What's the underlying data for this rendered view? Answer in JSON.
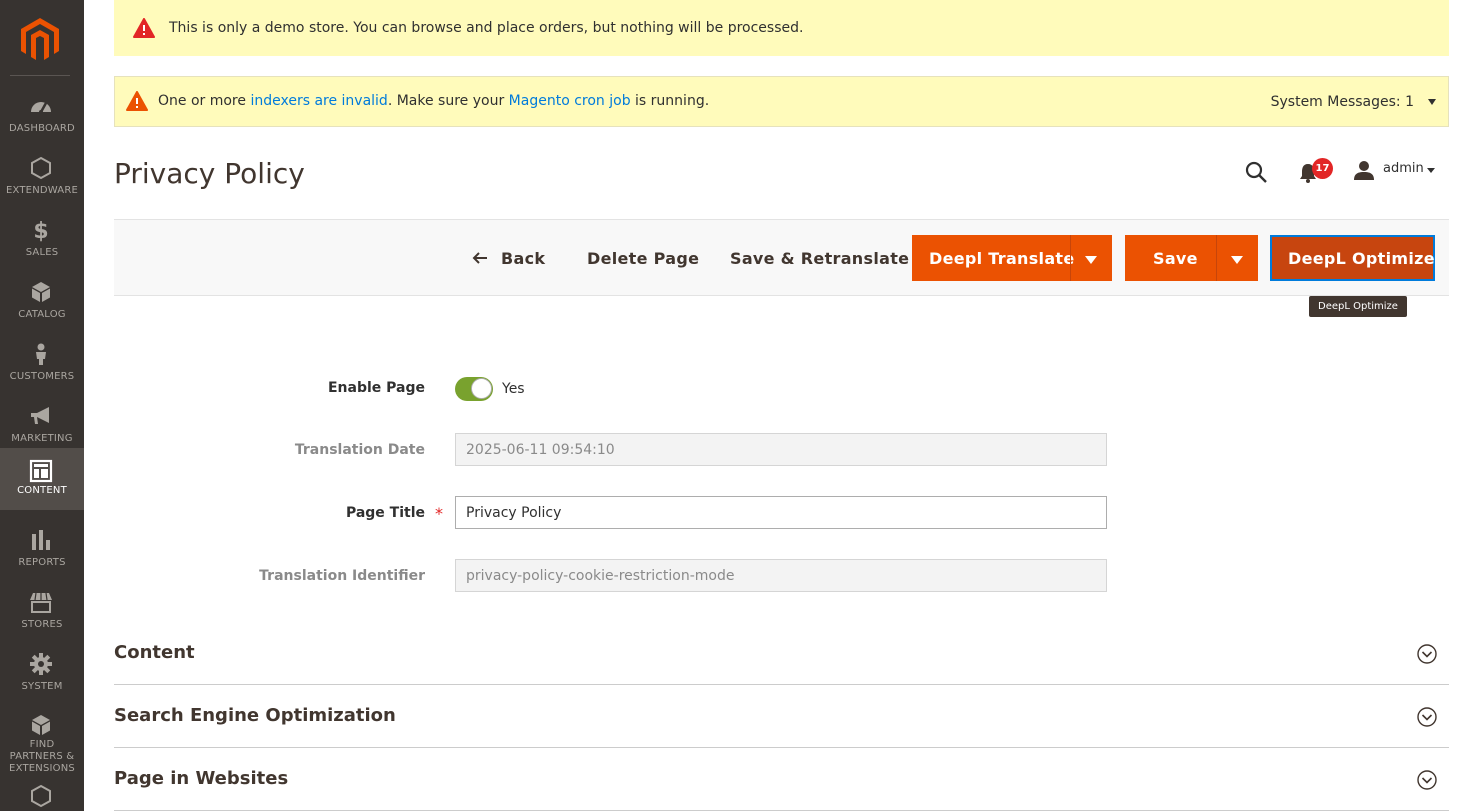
{
  "sidebar": {
    "items": [
      {
        "label": "DASHBOARD",
        "icon": "dashboard-icon"
      },
      {
        "label": "EXTENDWARE",
        "icon": "hexagon-icon"
      },
      {
        "label": "SALES",
        "icon": "dollar-icon"
      },
      {
        "label": "CATALOG",
        "icon": "box-icon"
      },
      {
        "label": "CUSTOMERS",
        "icon": "person-icon"
      },
      {
        "label": "MARKETING",
        "icon": "megaphone-icon"
      },
      {
        "label": "CONTENT",
        "icon": "layout-icon"
      },
      {
        "label": "REPORTS",
        "icon": "bar-chart-icon"
      },
      {
        "label": "STORES",
        "icon": "store-icon"
      },
      {
        "label": "SYSTEM",
        "icon": "gear-icon"
      },
      {
        "label": "FIND PARTNERS & EXTENSIONS",
        "icon": "blocks-icon"
      }
    ]
  },
  "notices": {
    "demo": "This is only a demo store. You can browse and place orders, but nothing will be processed.",
    "indexer_prefix": "One or more ",
    "indexer_link": "indexers are invalid",
    "indexer_middle": ". Make sure your ",
    "cron_link": "Magento cron job",
    "indexer_suffix": " is running.",
    "system_messages": "System Messages: 1"
  },
  "header": {
    "title": "Privacy Policy",
    "notifications_count": "17",
    "user": "admin"
  },
  "toolbar": {
    "back": "Back",
    "delete": "Delete Page",
    "save_retranslate": "Save & Retranslate",
    "deepl_translate": "Deepl Translate",
    "save": "Save",
    "deepl_optimize": "DeepL Optimize",
    "tooltip": "DeepL Optimize"
  },
  "form": {
    "enable_label": "Enable Page",
    "enable_value": "Yes",
    "translation_date_label": "Translation Date",
    "translation_date_value": "2025-06-11 09:54:10",
    "page_title_label": "Page Title",
    "page_title_value": "Privacy Policy",
    "required_mark": "*",
    "translation_identifier_label": "Translation Identifier",
    "translation_identifier_value": "privacy-policy-cookie-restriction-mode"
  },
  "sections": [
    {
      "title": "Content"
    },
    {
      "title": "Search Engine Optimization"
    },
    {
      "title": "Page in Websites"
    }
  ],
  "colors": {
    "accent": "#eb5202",
    "sidebar": "#373330",
    "toggle_on": "#79a22e",
    "link": "#007bdb"
  }
}
